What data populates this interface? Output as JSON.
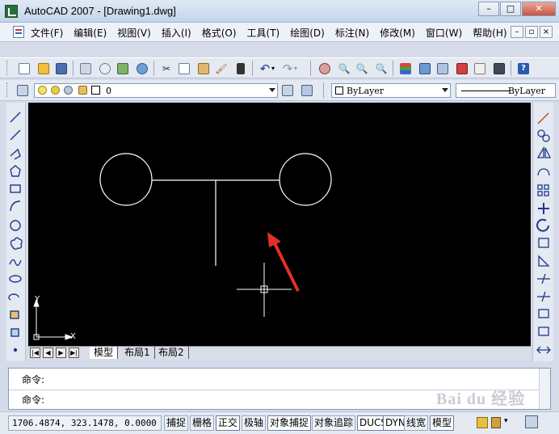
{
  "window": {
    "title": "AutoCAD 2007 - [Drawing1.dwg]",
    "buttons": {
      "minimize": "–",
      "maximize": "□",
      "close": "✕"
    }
  },
  "menu": {
    "items": [
      {
        "label": "文件(F)"
      },
      {
        "label": "编辑(E)"
      },
      {
        "label": "视图(V)"
      },
      {
        "label": "插入(I)"
      },
      {
        "label": "格式(O)"
      },
      {
        "label": "工具(T)"
      },
      {
        "label": "绘图(D)"
      },
      {
        "label": "标注(N)"
      },
      {
        "label": "修改(M)"
      },
      {
        "label": "窗口(W)"
      },
      {
        "label": "帮助(H)"
      }
    ],
    "mdi_buttons": {
      "minimize": "–",
      "restore": "▫",
      "close": "×"
    }
  },
  "layer_toolbar": {
    "current_layer": "0",
    "color": "ByLayer",
    "linetype": "ByLayer"
  },
  "layout_tabs": [
    {
      "label": "模型",
      "active": true
    },
    {
      "label": "布局1",
      "active": false
    },
    {
      "label": "布局2",
      "active": false
    }
  ],
  "ucs": {
    "x_label": "X",
    "y_label": "Y"
  },
  "command": {
    "line1": "命令:",
    "line2": "命令:"
  },
  "watermark": "Bai du 经验",
  "status": {
    "coordinates": "1706.4874, 323.1478, 0.0000",
    "toggles": [
      {
        "label": "捕捉",
        "on": false
      },
      {
        "label": "栅格",
        "on": false
      },
      {
        "label": "正交",
        "on": true
      },
      {
        "label": "极轴",
        "on": false
      },
      {
        "label": "对象捕捉",
        "on": true
      },
      {
        "label": "对象追踪",
        "on": false
      },
      {
        "label": "DUCS",
        "on": true
      },
      {
        "label": "DYN",
        "on": true
      },
      {
        "label": "线宽",
        "on": false
      },
      {
        "label": "模型",
        "on": true
      }
    ]
  },
  "colors": {
    "canvas": "#000000",
    "geometry": "#ffffff",
    "annotation_arrow": "#e0302a"
  }
}
